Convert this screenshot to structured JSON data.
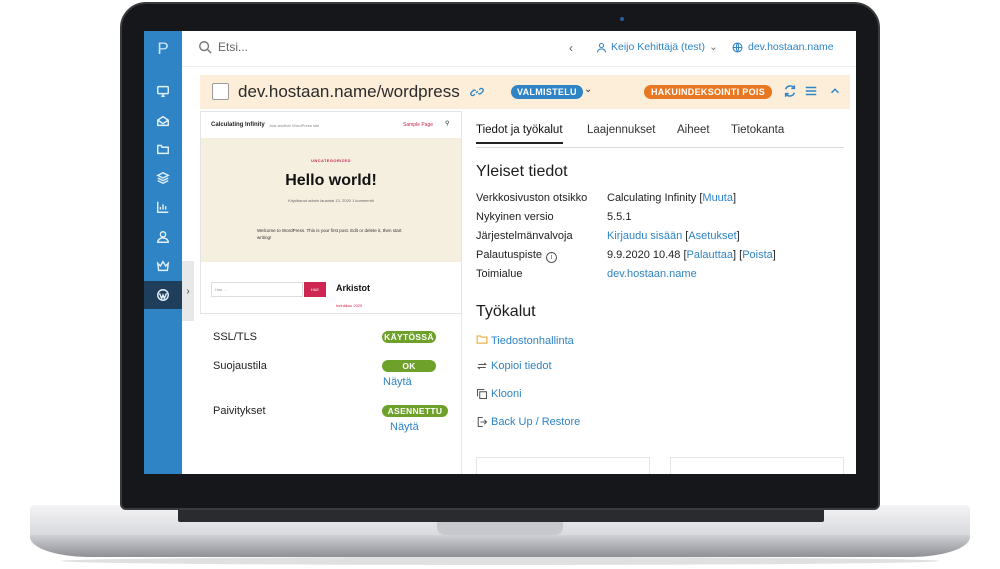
{
  "topbar": {
    "search_placeholder": "Etsi...",
    "back_glyph": "‹",
    "user_name": "Keijo Kehittäjä (test)",
    "user_caret": "⌄",
    "site_domain": "dev.hostaan.name"
  },
  "sidebar": {
    "logo": "P",
    "items": [
      "monitor-icon",
      "mail-icon",
      "folder-icon",
      "layers-icon",
      "chart-icon",
      "user-icon",
      "crown-icon",
      "wordpress-icon"
    ],
    "active_item": "wordpress-icon",
    "collapse_glyph": "›"
  },
  "site_header": {
    "title": "dev.hostaan.name/wordpress",
    "environment_badge": "VALMISTELU",
    "environment_caret": "⌄",
    "indexing_badge": "HAKUINDEKSOINTI POIS"
  },
  "preview": {
    "site_name": "Calculating Infinity",
    "tagline": "Just another WordPress site",
    "menu_link": "Sample Page",
    "category": "UNCATEGORIZED",
    "post_title": "Hello world!",
    "post_meta": "Kirjoittanut admin    lauantai 13, 2020    1 kommentti",
    "post_excerpt": "Welcome to WordPress. This is your first post. Edit or delete it, then start writing!",
    "search_placeholder": "Hae ...",
    "search_button": "HAE",
    "widget_title": "Arkistot",
    "widget_date": "heinäkuu 2020"
  },
  "status": {
    "ssl_label": "SSL/TLS",
    "ssl_badge": "KÄYTÖSSÄ",
    "protection_label": "Suojaustila",
    "protection_badge": "OK",
    "protection_link": "Näytä",
    "updates_label": "Paivitykset",
    "updates_badge": "ASENNETTU",
    "updates_link": "Näytä"
  },
  "tabs": [
    "Tiedot ja työkalut",
    "Laajennukset",
    "Aiheet",
    "Tietokanta"
  ],
  "active_tab": "Tiedot ja työkalut",
  "general": {
    "title": "Yleiset tiedot",
    "site_title_label": "Verkkosivuston otsikko",
    "site_title_value": "Calculating Infinity",
    "change_link": "Muuta",
    "version_label": "Nykyinen versio",
    "version_value": "5.5.1",
    "admin_label": "Järjestelmänvalvoja",
    "login_link": "Kirjaudu sisään",
    "settings_link": "Asetukset",
    "restore_label": "Palautuspiste",
    "restore_value": "9.9.2020 10.48",
    "restore_link": "Palauttaa",
    "delete_link": "Poista",
    "domain_label": "Toimialue",
    "domain_value": "dev.hostaan.name"
  },
  "tools": {
    "title": "Työkalut",
    "file_manager": "Tiedostonhallinta",
    "copy_data": "Kopioi tiedot",
    "clone": "Klooni",
    "backup": "Back Up / Restore"
  },
  "colors": {
    "accent": "#2e84c4",
    "sidebar_active": "#1f3e5c",
    "header_bg": "#fdeed9",
    "warning": "#e87722",
    "success": "#6ea12a",
    "wp_accent": "#cd2653"
  }
}
